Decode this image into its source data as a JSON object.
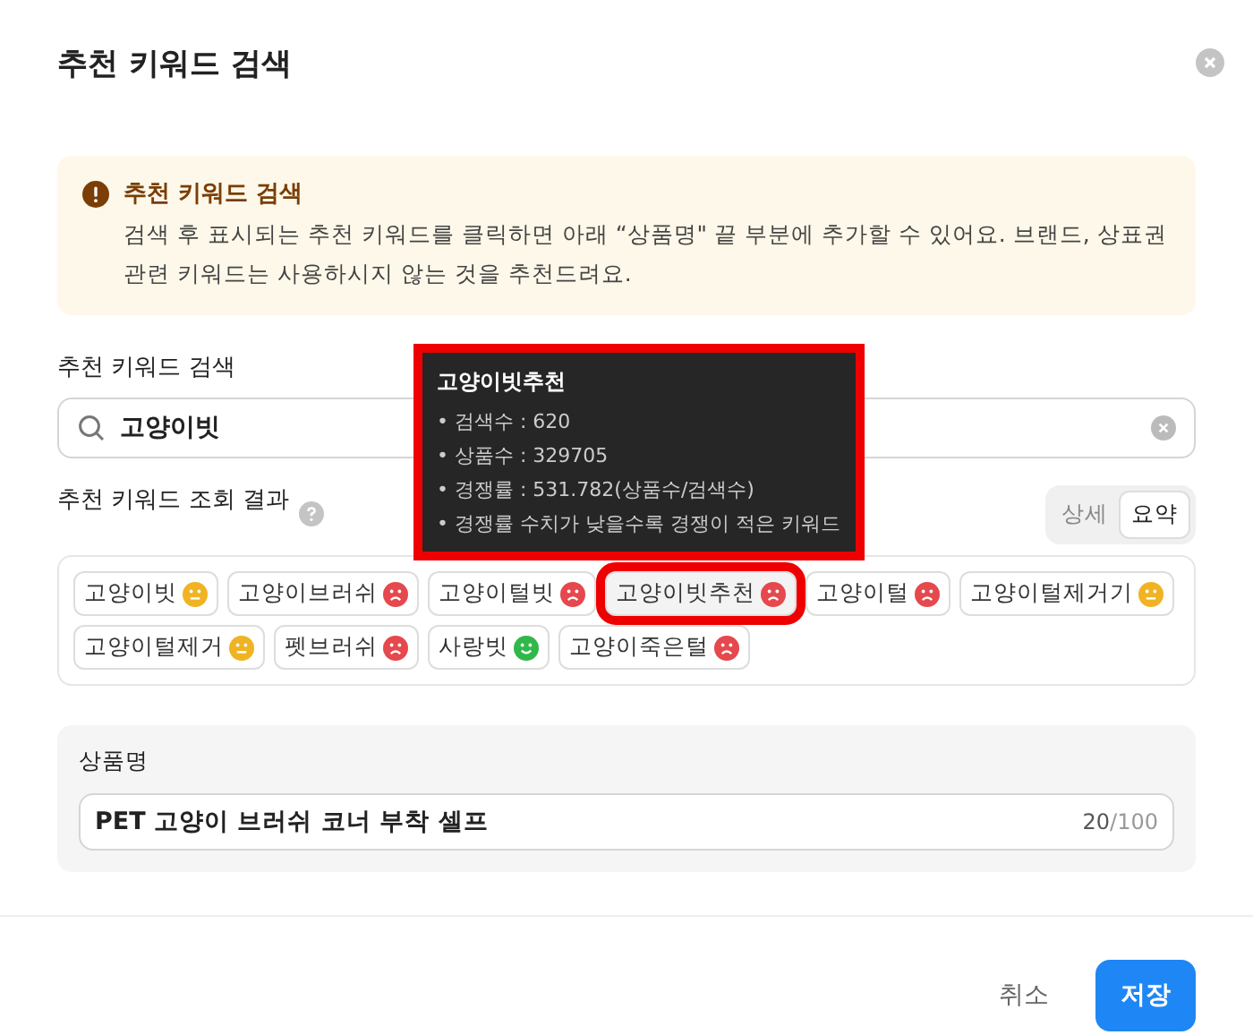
{
  "dialog": {
    "title": "추천 키워드 검색"
  },
  "notice": {
    "title": "추천 키워드 검색",
    "body": "검색 후 표시되는 추천 키워드를 클릭하면 아래 “상품명\" 끝 부분에 추가할 수 있어요. 브랜드, 상표권 관련 키워드는 사용하시지 않는 것을 추천드려요."
  },
  "search": {
    "label": "추천 키워드 검색",
    "value": "고양이빗"
  },
  "results": {
    "label": "추천 키워드 조회 결과",
    "view_tabs": [
      {
        "label": "상세",
        "selected": false
      },
      {
        "label": "요약",
        "selected": true
      }
    ],
    "keywords": [
      {
        "text": "고양이빗",
        "kind": "neutral",
        "highlighted": false
      },
      {
        "text": "고양이브러쉬",
        "kind": "sad",
        "highlighted": false
      },
      {
        "text": "고양이털빗",
        "kind": "sad",
        "highlighted": false
      },
      {
        "text": "고양이빗추천",
        "kind": "sad",
        "highlighted": true
      },
      {
        "text": "고양이털",
        "kind": "sad",
        "highlighted": false
      },
      {
        "text": "고양이털제거기",
        "kind": "neutral",
        "highlighted": false
      },
      {
        "text": "고양이털제거",
        "kind": "neutral",
        "highlighted": false
      },
      {
        "text": "펫브러쉬",
        "kind": "sad",
        "highlighted": false
      },
      {
        "text": "사랑빗",
        "kind": "happy",
        "highlighted": false
      },
      {
        "text": "고양이죽은털",
        "kind": "sad",
        "highlighted": false
      }
    ]
  },
  "tooltip": {
    "title": "고양이빗추천",
    "highlighted": true,
    "lines": [
      "• 검색수 : 620",
      "• 상품수 : 329705",
      "• 경쟁률 : 531.782(상품수/검색수)",
      "• 경쟁률 수치가 낮을수록 경쟁이 적은 키워드"
    ]
  },
  "product_name": {
    "label": "상품명",
    "value": "PET 고양이 브러쉬 코너 부착 셀프",
    "count": "20",
    "max": "/100"
  },
  "buttons": {
    "cancel": "취소",
    "save": "저장"
  }
}
